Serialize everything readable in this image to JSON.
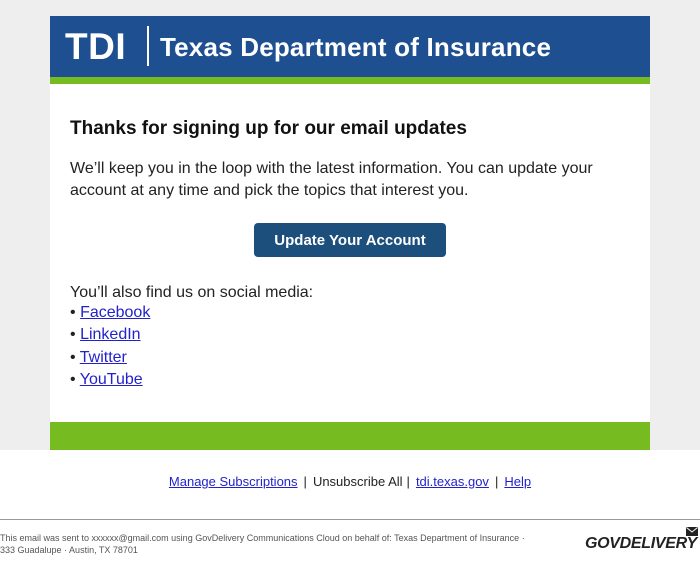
{
  "header": {
    "logo_short": "TDI",
    "org_name": "Texas Department of Insurance",
    "brand_blue": "#1d4f91",
    "brand_green": "#76bc21"
  },
  "body": {
    "title": "Thanks for signing up for our email updates",
    "intro": "We’ll keep you in the loop with the latest information. You can update your account at any time and pick the topics that interest you.",
    "cta_label": "Update Your Account",
    "social_lead": "You’ll also find us on social media:",
    "social_links": [
      {
        "bullet": "•",
        "label": "Facebook"
      },
      {
        "bullet": "•",
        "label": "LinkedIn"
      },
      {
        "bullet": "•",
        "label": "Twitter"
      },
      {
        "bullet": "•",
        "label": "YouTube"
      }
    ]
  },
  "footer": {
    "manage": "Manage Subscriptions",
    "sep1": "|",
    "unsubscribe": "Unsubscribe All",
    "sep2": "|",
    "site": "tdi.texas.gov",
    "sep3": "|",
    "help": "Help",
    "disclaimer_line1": "This email was sent to xxxxxx@gmail.com using GovDelivery Communications Cloud on behalf of: Texas Department of Insurance ·",
    "disclaimer_line2": "333 Guadalupe · Austin, TX 78701",
    "gov_logo": "GOVDELIVERY",
    "gov_icon": "envelope-icon"
  }
}
